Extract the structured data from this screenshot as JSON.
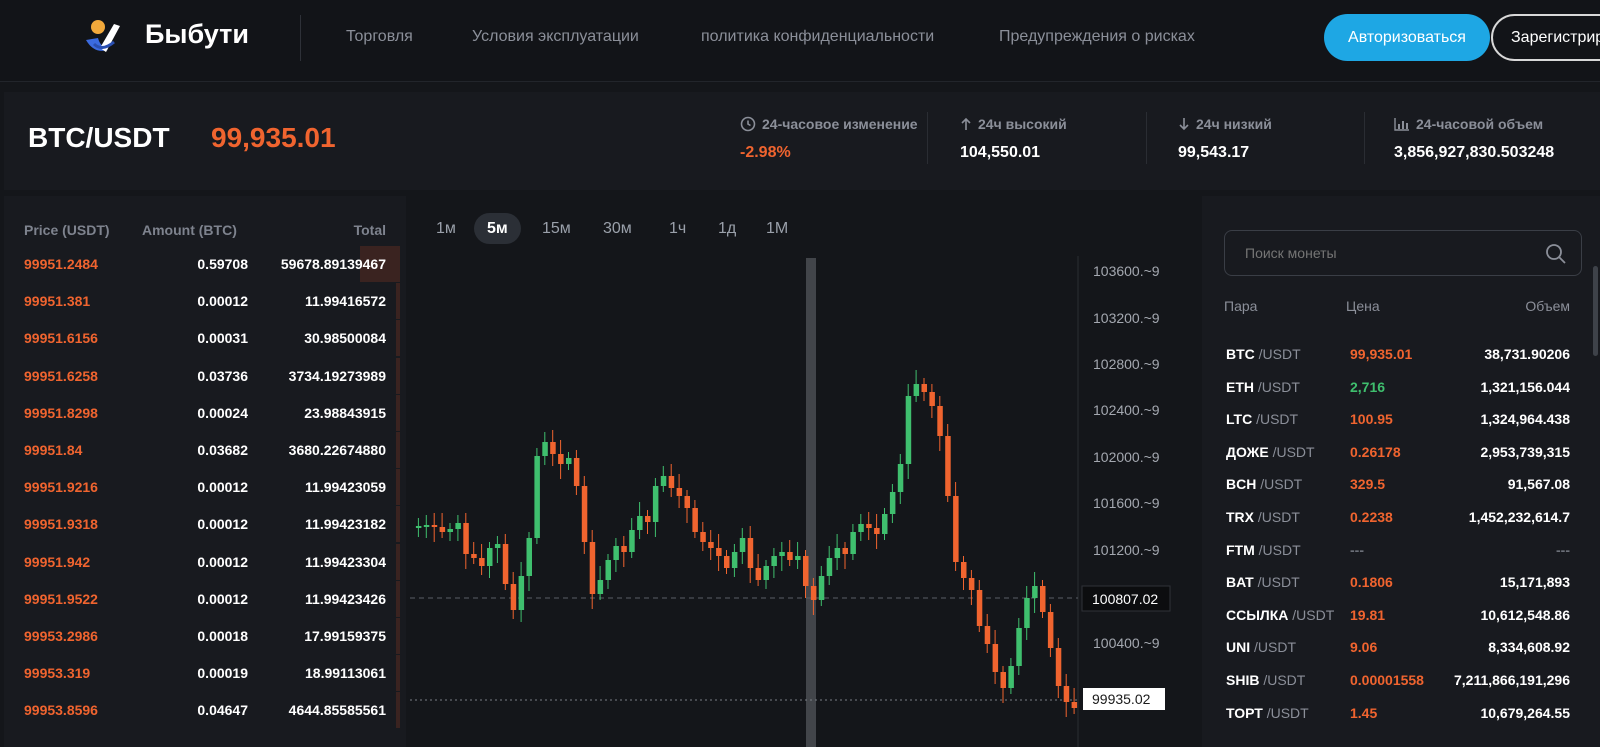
{
  "header": {
    "brand": "Быбути",
    "nav": [
      "Торговля",
      "Условия эксплуатации",
      "политика конфиденциальности",
      "Предупреждения о рисках"
    ],
    "login_label": "Авторизоваться",
    "register_label": "Зарегистрир"
  },
  "ticker": {
    "pair": "BTC/USDT",
    "price": "99,935.01",
    "change_label": "24-часовое изменение",
    "change_value": "-2.98%",
    "high_label": "24ч высокий",
    "high_value": "104,550.01",
    "low_label": "24ч низкий",
    "low_value": "99,543.17",
    "volume_label": "24-часовой объем",
    "volume_value": "3,856,927,830.503248"
  },
  "orderbook": {
    "headers": {
      "price": "Price (USDT)",
      "amount": "Amount (BTC)",
      "total": "Total"
    },
    "rows": [
      {
        "price": "99951.2484",
        "amount": "0.59708",
        "total": "59678.89139467",
        "depth": 0.1
      },
      {
        "price": "99951.381",
        "amount": "0.00012",
        "total": "11.99416572",
        "depth": 0.01
      },
      {
        "price": "99951.6156",
        "amount": "0.00031",
        "total": "30.98500084",
        "depth": 0.01
      },
      {
        "price": "99951.6258",
        "amount": "0.03736",
        "total": "3734.19273989",
        "depth": 0.01
      },
      {
        "price": "99951.8298",
        "amount": "0.00024",
        "total": "23.98843915",
        "depth": 0.01
      },
      {
        "price": "99951.84",
        "amount": "0.03682",
        "total": "3680.22674880",
        "depth": 0.01
      },
      {
        "price": "99951.9216",
        "amount": "0.00012",
        "total": "11.99423059",
        "depth": 0.01
      },
      {
        "price": "99951.9318",
        "amount": "0.00012",
        "total": "11.99423182",
        "depth": 0.01
      },
      {
        "price": "99951.942",
        "amount": "0.00012",
        "total": "11.99423304",
        "depth": 0.01
      },
      {
        "price": "99951.9522",
        "amount": "0.00012",
        "total": "11.99423426",
        "depth": 0.01
      },
      {
        "price": "99953.2986",
        "amount": "0.00018",
        "total": "17.99159375",
        "depth": 0.01
      },
      {
        "price": "99953.319",
        "amount": "0.00019",
        "total": "18.99113061",
        "depth": 0.01
      },
      {
        "price": "99953.8596",
        "amount": "0.04647",
        "total": "4644.85585561",
        "depth": 0.01
      }
    ]
  },
  "chart": {
    "timeframes": [
      "1м",
      "5м",
      "15м",
      "30м",
      "1ч",
      "1д",
      "1М"
    ],
    "active_timeframe": "5м",
    "axis_labels": [
      "103600.~9",
      "103200.~9",
      "102800.~9",
      "102400.~9",
      "102000.~9",
      "101600.~9",
      "101200.~9",
      "100400.~9"
    ],
    "crosshair_value": "100807.02",
    "last_price_tag": "99935.02",
    "up_color": "#3fbf6e",
    "down_color": "#f0642f"
  },
  "market": {
    "search_placeholder": "Поиск монеты",
    "headers": {
      "pair": "Пара",
      "price": "Цена",
      "volume": "Объем"
    },
    "rows": [
      {
        "base": "BTC",
        "quote": "/USDT",
        "price": "99,935.01",
        "volume": "38,731.90206",
        "trend": "down"
      },
      {
        "base": "ETH",
        "quote": "/USDT",
        "price": "2,716",
        "volume": "1,321,156.044",
        "trend": "up"
      },
      {
        "base": "LTC",
        "quote": "/USDT",
        "price": "100.95",
        "volume": "1,324,964.438",
        "trend": "down"
      },
      {
        "base": "ДОЖЕ",
        "quote": "/USDT",
        "price": "0.26178",
        "volume": "2,953,739,315",
        "trend": "down"
      },
      {
        "base": "BCH",
        "quote": "/USDT",
        "price": "329.5",
        "volume": "91,567.08",
        "trend": "down"
      },
      {
        "base": "TRX",
        "quote": "/USDT",
        "price": "0.2238",
        "volume": "1,452,232,614.7",
        "trend": "down"
      },
      {
        "base": "FTM",
        "quote": "/USDT",
        "price": "---",
        "volume": "---",
        "trend": "na"
      },
      {
        "base": "BAT",
        "quote": "/USDT",
        "price": "0.1806",
        "volume": "15,171,893",
        "trend": "down"
      },
      {
        "base": "ССЫЛКА",
        "quote": "/USDT",
        "price": "19.81",
        "volume": "10,612,548.86",
        "trend": "down"
      },
      {
        "base": "UNI",
        "quote": "/USDT",
        "price": "9.06",
        "volume": "8,334,608.92",
        "trend": "down"
      },
      {
        "base": "SHIB",
        "quote": "/USDT",
        "price": "0.00001558",
        "volume": "7,211,866,191,296",
        "trend": "down"
      },
      {
        "base": "ТОРТ",
        "quote": "/USDT",
        "price": "1.45",
        "volume": "10,679,264.55",
        "trend": "down"
      }
    ]
  }
}
